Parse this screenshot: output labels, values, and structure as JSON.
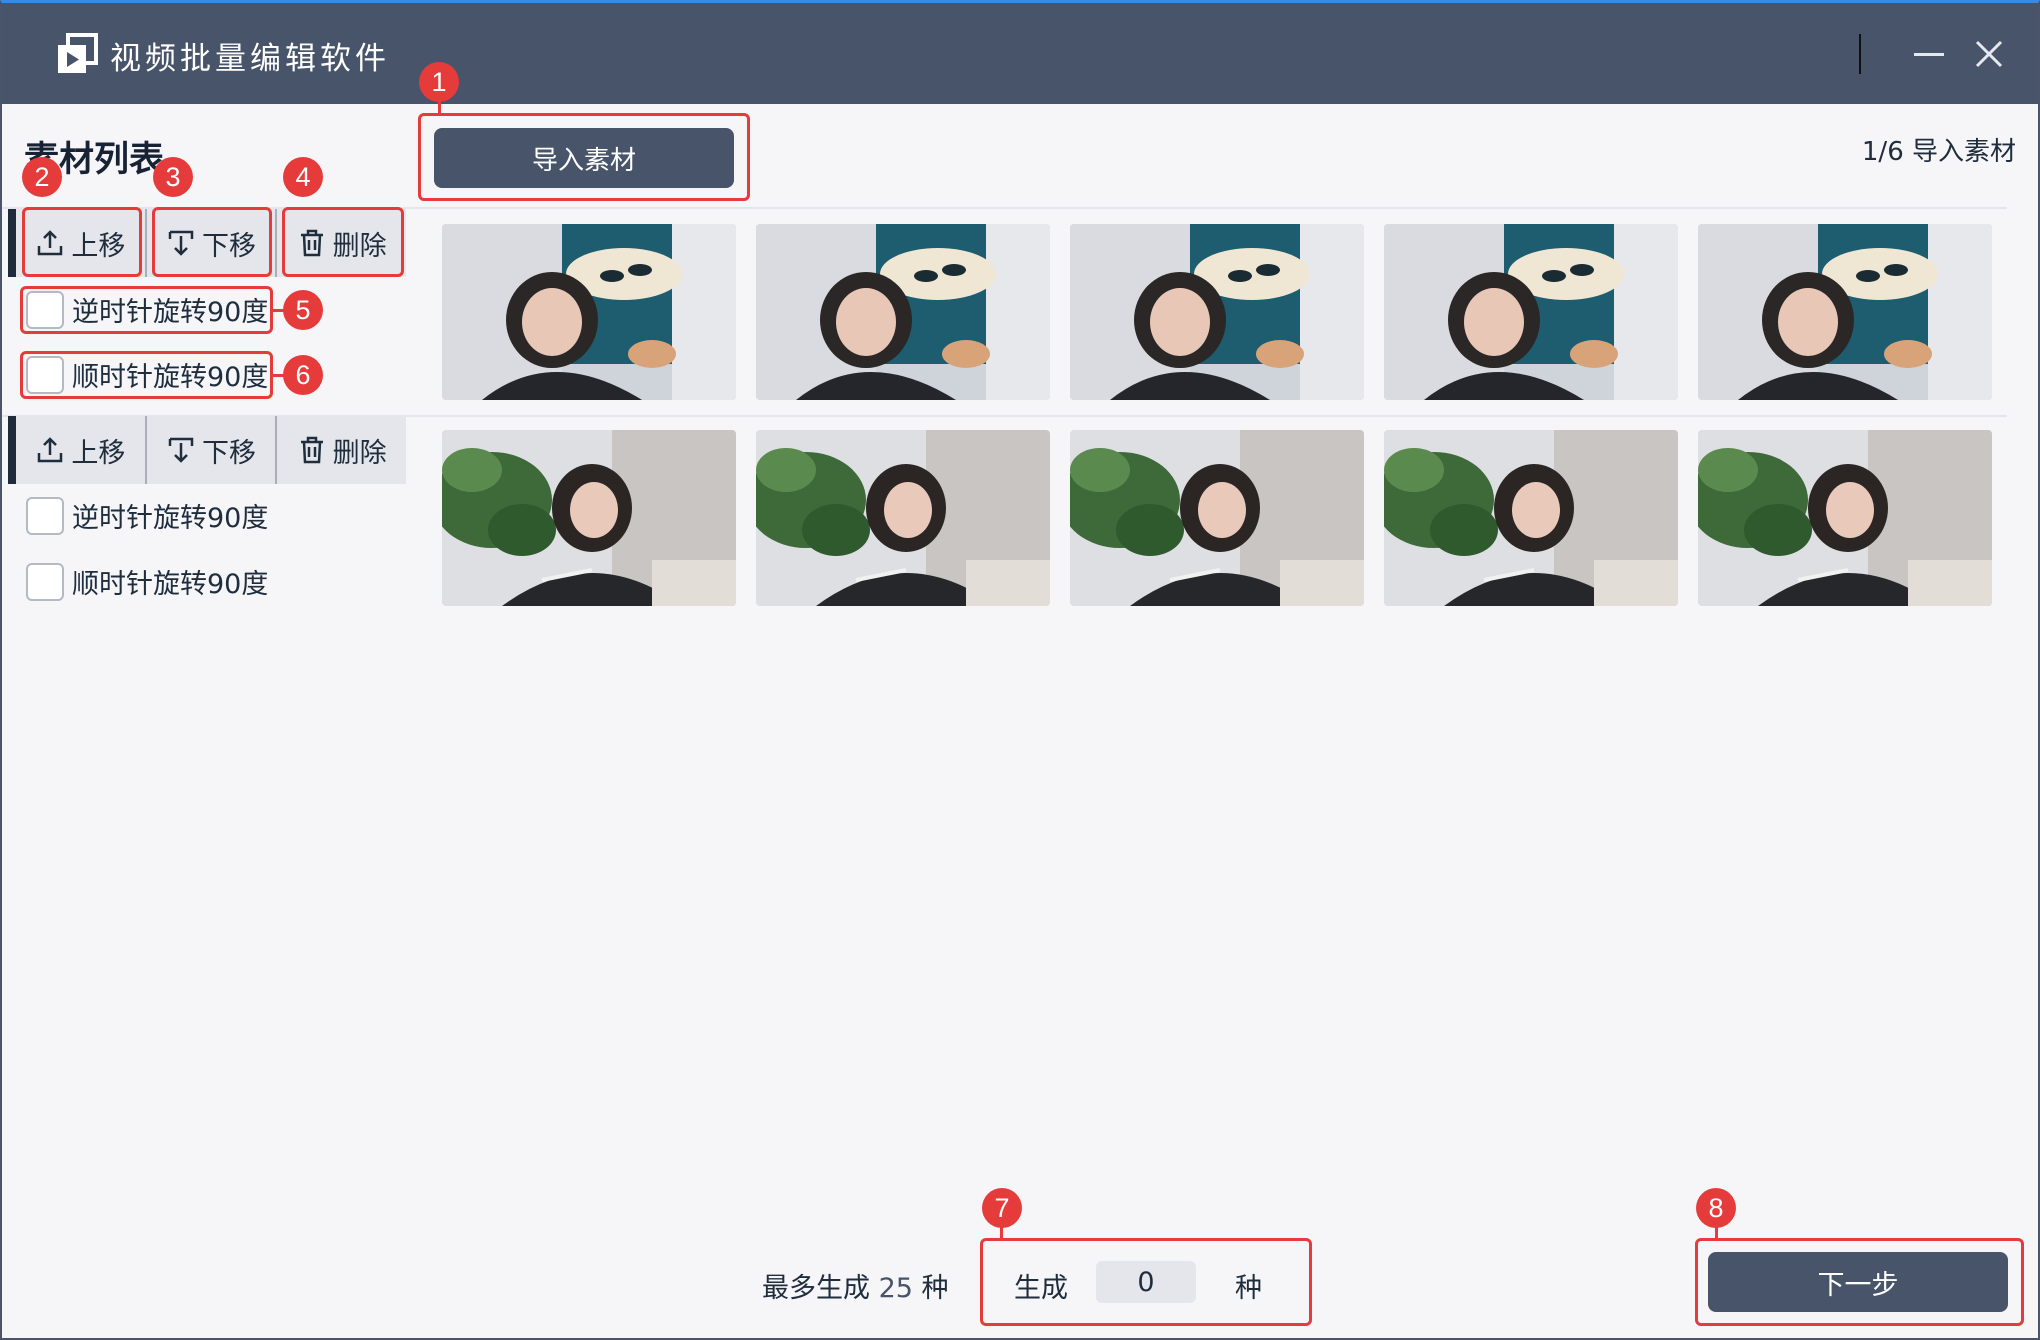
{
  "window": {
    "title": "视频批量编辑软件"
  },
  "header": {
    "section_title": "素材列表",
    "import_button": "导入素材",
    "counter": "1/6 导入素材"
  },
  "materials": [
    {
      "move_up": "上移",
      "move_down": "下移",
      "delete": "删除",
      "rotate_ccw": "逆时针旋转90度",
      "rotate_cw": "顺时针旋转90度",
      "frames": 5
    },
    {
      "move_up": "上移",
      "move_down": "下移",
      "delete": "删除",
      "rotate_ccw": "逆时针旋转90度",
      "rotate_cw": "顺时针旋转90度",
      "frames": 5
    }
  ],
  "footer": {
    "max_prefix": "最多生成",
    "max_value": "25",
    "max_suffix": "种",
    "gen_label": "生成",
    "gen_value": "0",
    "gen_unit": "种",
    "next_button": "下一步"
  },
  "annotations": [
    "1",
    "2",
    "3",
    "4",
    "5",
    "6",
    "7",
    "8"
  ],
  "colors": {
    "titlebar": "#48546a",
    "accent_button": "#48546a",
    "annotation": "#e63b3b",
    "background": "#f6f6f9"
  },
  "icons": [
    "app-logo-icon",
    "minimize-icon",
    "close-icon",
    "upload-icon",
    "download-icon",
    "trash-icon"
  ]
}
